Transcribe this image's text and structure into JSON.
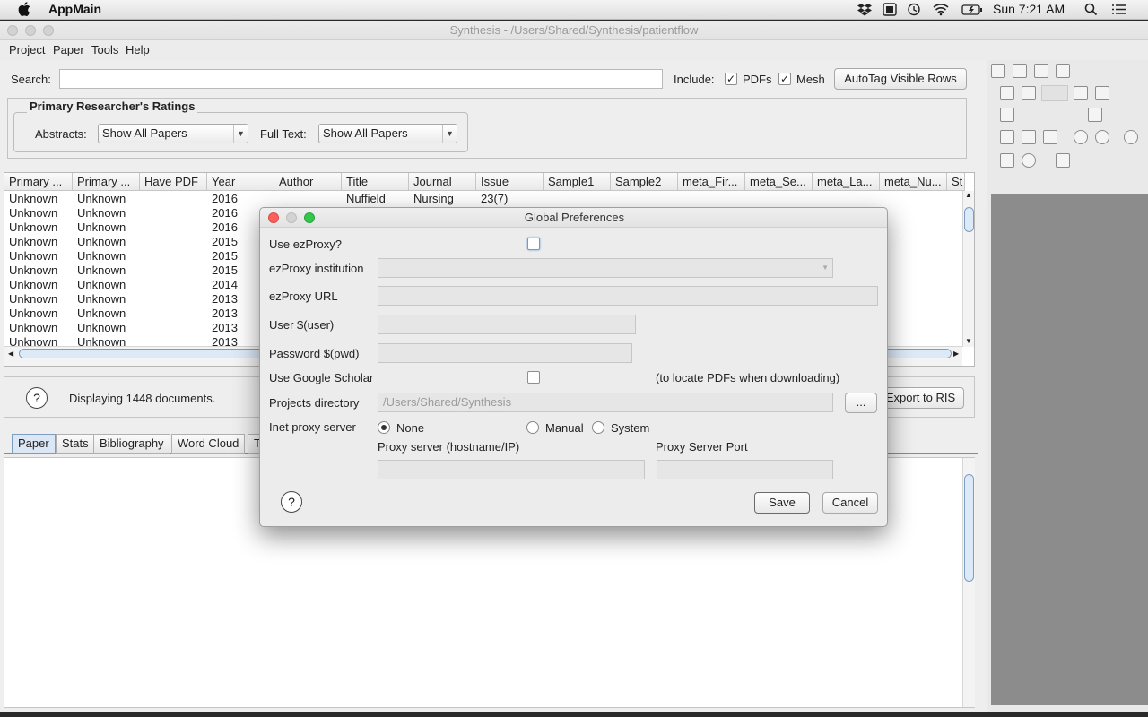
{
  "menubar": {
    "apple": "",
    "app_name": "AppMain",
    "clock": "Sun 7:21 AM"
  },
  "window": {
    "title": "Synthesis - /Users/Shared/Synthesis/patientflow"
  },
  "app_menu": [
    "Project",
    "Paper",
    "Tools",
    "Help"
  ],
  "search": {
    "label": "Search:",
    "value": "",
    "include_label": "Include:",
    "pdfs_label": "PDFs",
    "pdfs_checked": true,
    "mesh_label": "Mesh",
    "mesh_checked": true,
    "autotag_label": "AutoTag Visible Rows"
  },
  "ratings": {
    "title": "Primary Researcher's  Ratings",
    "abstracts_label": "Abstracts:",
    "abstracts_value": "Show All Papers",
    "fulltext_label": "Full Text:",
    "fulltext_value": "Show All Papers"
  },
  "table": {
    "columns": [
      "Primary ...",
      "Primary ...",
      "Have PDF",
      "Year",
      "Author",
      "Title",
      "Journal",
      "Issue",
      "Sample1",
      "Sample2",
      "meta_Fir...",
      "meta_Se...",
      "meta_La...",
      "meta_Nu...",
      "St"
    ],
    "rows": [
      [
        "Unknown",
        "Unknown",
        "",
        "2016",
        "",
        "Nuffield",
        "Nursing",
        "23(7)"
      ],
      [
        "Unknown",
        "Unknown",
        "",
        "2016"
      ],
      [
        "Unknown",
        "Unknown",
        "",
        "2016"
      ],
      [
        "Unknown",
        "Unknown",
        "",
        "2015"
      ],
      [
        "Unknown",
        "Unknown",
        "",
        "2015"
      ],
      [
        "Unknown",
        "Unknown",
        "",
        "2015"
      ],
      [
        "Unknown",
        "Unknown",
        "",
        "2014"
      ],
      [
        "Unknown",
        "Unknown",
        "",
        "2013"
      ],
      [
        "Unknown",
        "Unknown",
        "",
        "2013"
      ],
      [
        "Unknown",
        "Unknown",
        "",
        "2013"
      ],
      [
        "Unknown",
        "Unknown",
        "",
        "2013"
      ]
    ]
  },
  "status": {
    "help": "?",
    "displaying": "Displaying 1448 documents.",
    "export_label": "Export to RIS"
  },
  "tabs": [
    "Paper",
    "Stats",
    "Bibliography",
    "Word Cloud",
    "T"
  ],
  "dialog": {
    "title": "Global Preferences",
    "use_ezproxy_label": "Use ezProxy?",
    "use_ezproxy_checked": false,
    "ezproxy_institution_label": "ezProxy institution",
    "ezproxy_institution_value": "",
    "ezproxy_url_label": "ezProxy URL",
    "ezproxy_url_value": "",
    "user_label": "User $(user)",
    "user_value": "",
    "password_label": "Password $(pwd)",
    "password_value": "",
    "google_scholar_label": "Use Google Scholar",
    "google_scholar_checked": false,
    "google_scholar_note": "(to locate PDFs when downloading)",
    "projects_dir_label": "Projects directory",
    "projects_dir_value": "/Users/Shared/Synthesis",
    "browse_label": "...",
    "inet_proxy_label": "Inet proxy server",
    "proxy_options": [
      "None",
      "Manual",
      "System"
    ],
    "proxy_selected": "None",
    "proxy_server_label": "Proxy server (hostname/IP)",
    "proxy_server_value": "",
    "proxy_port_label": "Proxy Server Port",
    "proxy_port_value": "",
    "help": "?",
    "save_label": "Save",
    "cancel_label": "Cancel"
  }
}
